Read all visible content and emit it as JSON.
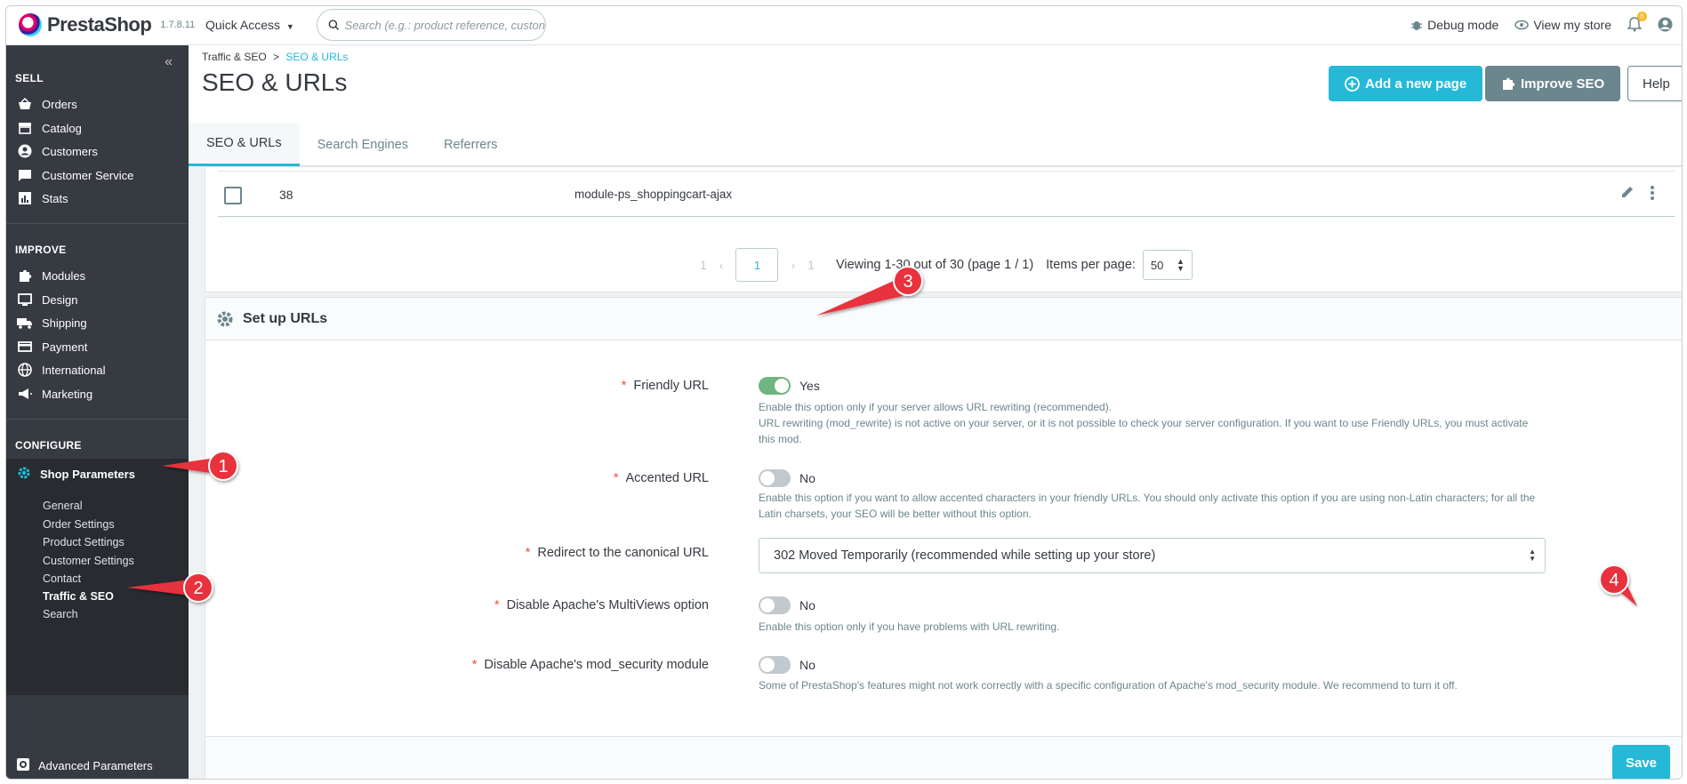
{
  "header": {
    "brand": "PrestaShop",
    "version": "1.7.8.11",
    "quick_access": "Quick Access",
    "search_placeholder": "Search (e.g.: product reference, custon",
    "debug_mode": "Debug mode",
    "view_store": "View my store",
    "notif_count": "6"
  },
  "sidebar": {
    "collapse": "«",
    "sections": {
      "sell": "SELL",
      "improve": "IMPROVE",
      "configure": "CONFIGURE"
    },
    "sell_items": [
      "Orders",
      "Catalog",
      "Customers",
      "Customer Service",
      "Stats"
    ],
    "improve_items": [
      "Modules",
      "Design",
      "Shipping",
      "Payment",
      "International",
      "Marketing"
    ],
    "shop_parameters": "Shop Parameters",
    "sub_items": [
      "General",
      "Order Settings",
      "Product Settings",
      "Customer Settings",
      "Contact",
      "Traffic & SEO",
      "Search"
    ],
    "advanced": "Advanced Parameters"
  },
  "page": {
    "breadcrumb_parent": "Traffic & SEO",
    "breadcrumb_sep": ">",
    "breadcrumb_current": "SEO & URLs",
    "title": "SEO & URLs",
    "btn_add": "Add a new page",
    "btn_improve": "Improve SEO",
    "btn_help": "Help",
    "tabs": [
      "SEO & URLs",
      "Search Engines",
      "Referrers"
    ]
  },
  "table": {
    "row_id": "38",
    "row_name": "module-ps_shoppingcart-ajax",
    "pager_first": "1",
    "pager_current": "1",
    "pager_last": "1",
    "viewing": "Viewing 1-30 out of 30 (page 1 / 1)",
    "items_per_page": "Items per page:",
    "items_value": "50"
  },
  "setup": {
    "title": "Set up URLs",
    "required_mark": "*",
    "friendly_label": "Friendly URL",
    "friendly_value": "Yes",
    "friendly_help_1": "Enable this option only if your server allows URL rewriting (recommended).",
    "friendly_help_2": "URL rewriting (mod_rewrite) is not active on your server, or it is not possible to check your server configuration. If you want to use Friendly URLs, you must activate this mod.",
    "accented_label": "Accented URL",
    "accented_value": "No",
    "accented_help": "Enable this option if you want to allow accented characters in your friendly URLs. You should only activate this option if you are using non-Latin characters; for all the Latin charsets, your SEO will be better without this option.",
    "canonical_label": "Redirect to the canonical URL",
    "canonical_value": "302 Moved Temporarily (recommended while setting up your store)",
    "multiviews_label": "Disable Apache's MultiViews option",
    "multiviews_value": "No",
    "multiviews_help": "Enable this option only if you have problems with URL rewriting.",
    "modsec_label": "Disable Apache's mod_security module",
    "modsec_value": "No",
    "modsec_help": "Some of PrestaShop's features might not work correctly with a specific configuration of Apache's mod_security module. We recommend to turn it off.",
    "save": "Save"
  },
  "annotations": [
    "1",
    "2",
    "3",
    "4"
  ],
  "colors": {
    "accent": "#25b9d7",
    "sidebar": "#363a41",
    "callout": "#e8333c",
    "toggle_on": "#70b580"
  }
}
